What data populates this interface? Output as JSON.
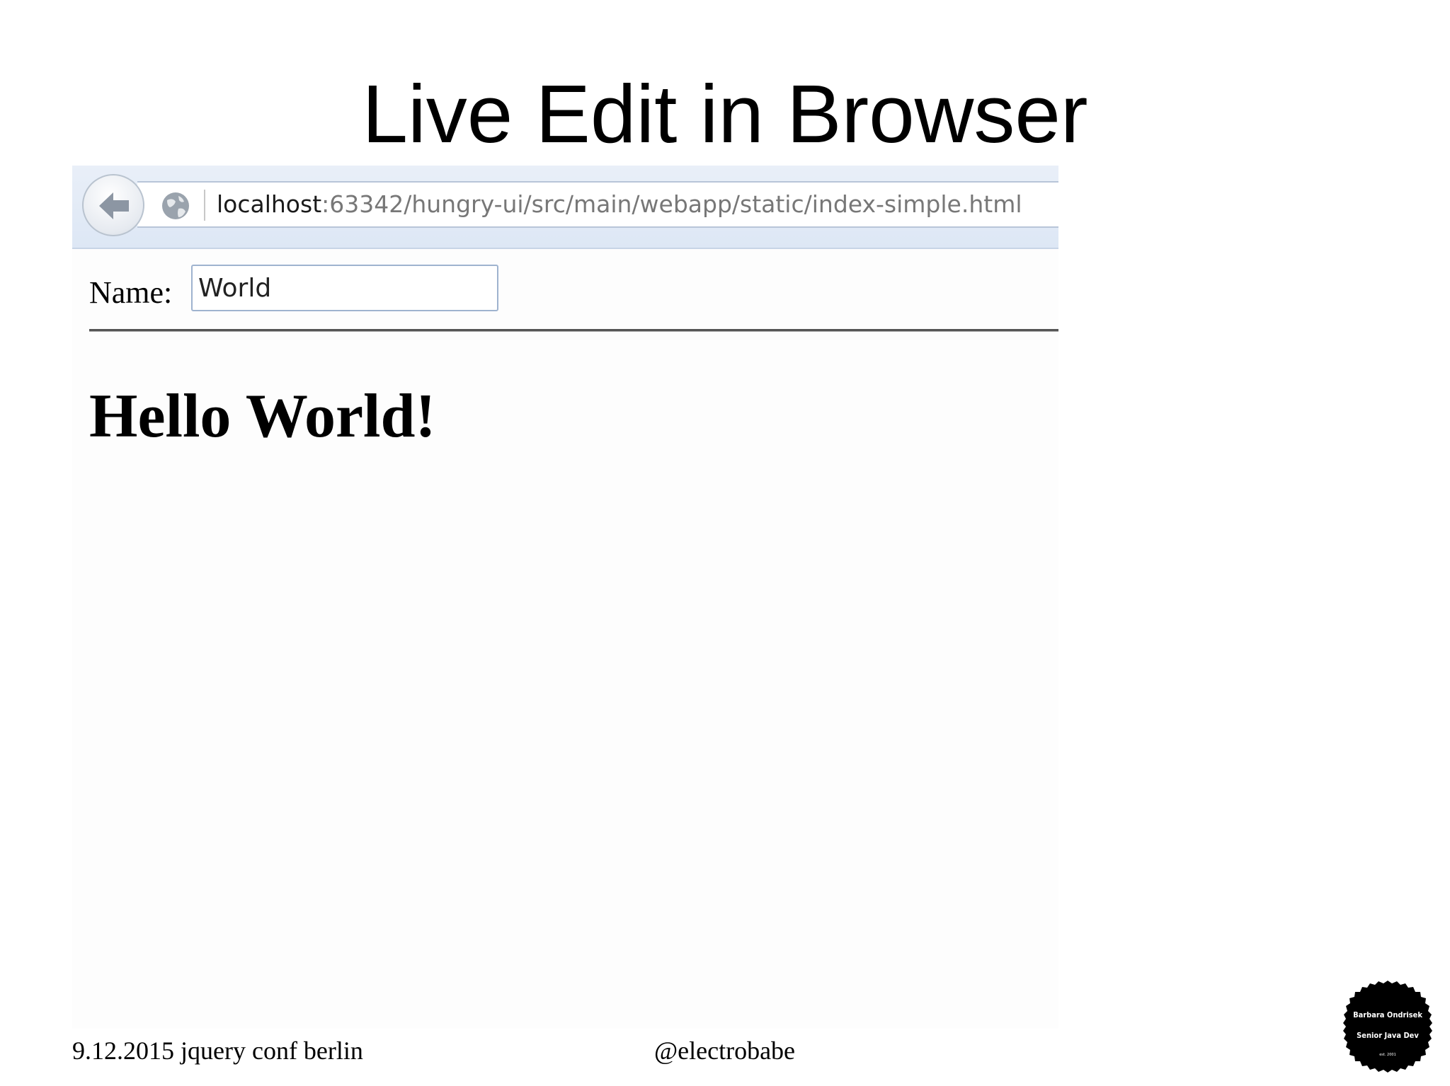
{
  "slide": {
    "title": "Live Edit in Browser",
    "footer_left": "9.12.2015 jquery conf berlin",
    "footer_center": "@electrobabe",
    "badge": {
      "line1": "Barbara Ondrisek",
      "line2": "Senior Java Dev",
      "line3": "est. 2001"
    }
  },
  "browser": {
    "back_icon": "back-arrow-icon",
    "site_icon": "globe-icon",
    "url_host": "localhost",
    "url_rest": ":63342/hungry-ui/src/main/webapp/static/index-simple.html"
  },
  "page": {
    "name_label": "Name:",
    "name_value": "World",
    "greeting": "Hello World!"
  }
}
